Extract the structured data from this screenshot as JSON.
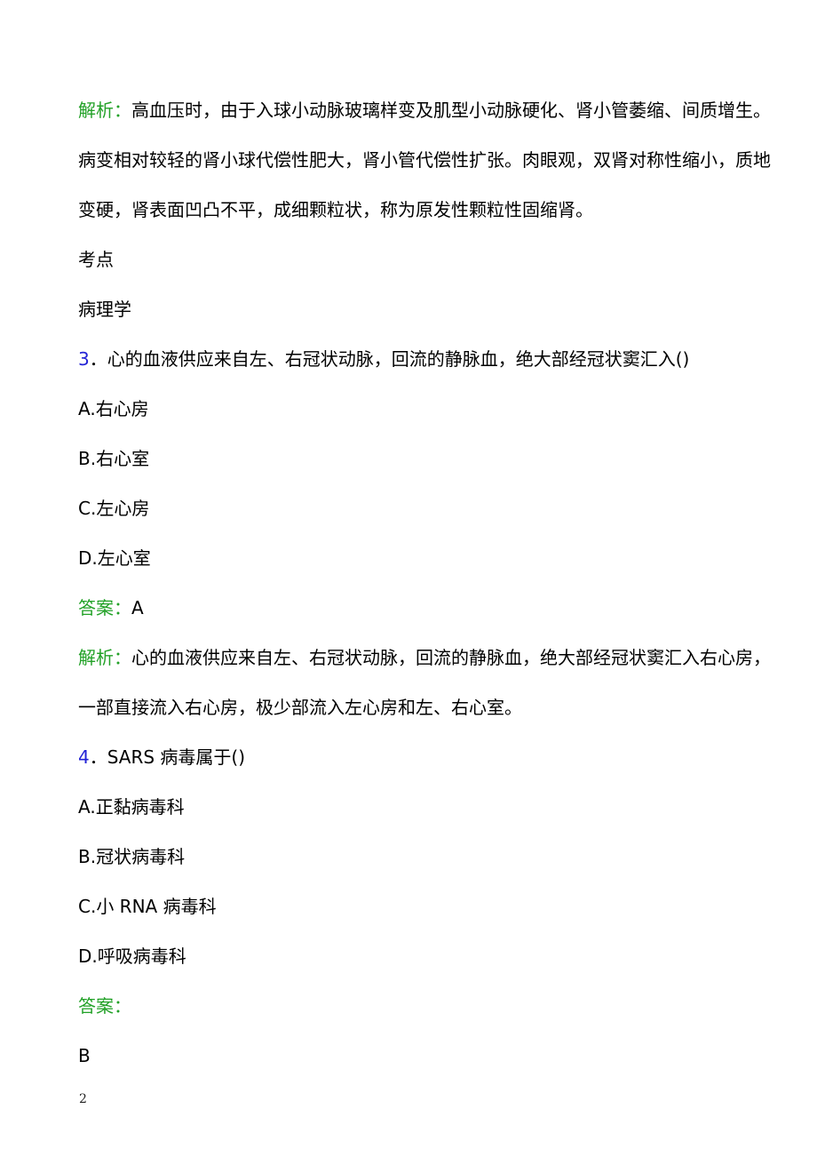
{
  "document": {
    "page_number": "2",
    "colors": {
      "label_green": "#22a127",
      "number_blue": "#2323d6",
      "body_black": "#000000",
      "page_background": "#ffffff"
    }
  },
  "blocks": {
    "explanation_1": {
      "label": "解析：",
      "line1": "高血压时，由于入球小动脉玻璃样变及肌型小动脉硬化、肾小管萎缩、间质增生。",
      "line2": "病变相对较轻的肾小球代偿性肥大，肾小管代偿性扩张。肉眼观，双肾对称性缩小，质地",
      "line3": "变硬，肾表面凹凸不平，成细颗粒状，称为原发性颗粒性固缩肾。"
    },
    "kaodian": {
      "heading": "考点",
      "value": "病理学"
    },
    "question_3": {
      "number": "3",
      "separator": "．",
      "stem": "心的血液供应来自左、右冠状动脉，回流的静脉血，绝大部经冠状窦汇入()",
      "options": [
        "A.右心房",
        "B.右心室",
        "C.左心房",
        "D.左心室"
      ],
      "answer_label": "答案：",
      "answer_value": "A",
      "explanation_label": "解析：",
      "explanation_line1": "心的血液供应来自左、右冠状动脉，回流的静脉血，绝大部经冠状窦汇入右心房，",
      "explanation_line2": "一部直接流入右心房，极少部流入左心房和左、右心室。"
    },
    "question_4": {
      "number": "4",
      "separator": "．",
      "stem": "SARS 病毒属于()",
      "options": [
        "A.正黏病毒科",
        "B.冠状病毒科",
        "C.小 RNA 病毒科",
        "D.呼吸病毒科"
      ],
      "answer_label": "答案：",
      "answer_value": "B"
    }
  }
}
